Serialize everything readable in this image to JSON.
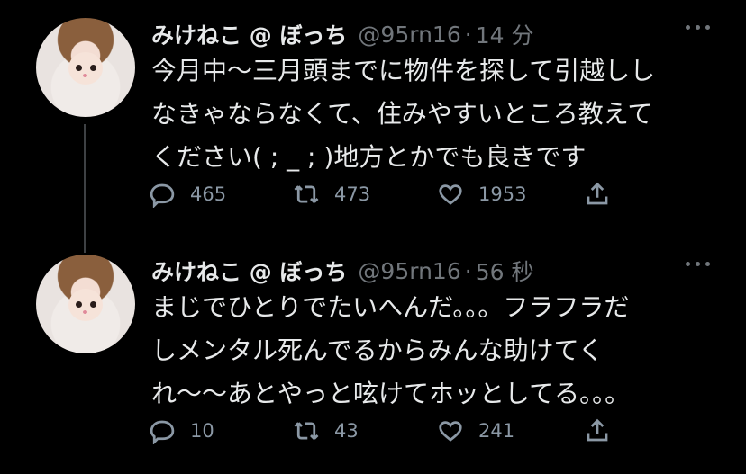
{
  "tweets": [
    {
      "name": "みけねこ @ ぼっち",
      "handle": "@95rn16",
      "separator": "·",
      "time": "14 分",
      "text": "今月中〜三月頭までに物件を探して引越しし\nなきゃならなくて、住みやすいところ教えて\nください( ; _ ; )地方とかでも良きです",
      "replies": "465",
      "retweets": "473",
      "likes": "1953"
    },
    {
      "name": "みけねこ @ ぼっち",
      "handle": "@95rn16",
      "separator": "·",
      "time": "56 秒",
      "text": "まじでひとりでたいへんだ。。。フラフラだ\nしメンタル死んでるからみんな助けてく\nれ〜〜あとやっと呟けてホッとしてる。。。",
      "replies": "10",
      "retweets": "43",
      "likes": "241"
    }
  ],
  "icons": {
    "reply": "reply-icon",
    "retweet": "retweet-icon",
    "like": "heart-icon",
    "share": "share-icon",
    "more": "more-icon"
  },
  "colors": {
    "background": "#000000",
    "text": "#e7e9ea",
    "muted": "#71767b",
    "thread_line": "#3e4144"
  }
}
